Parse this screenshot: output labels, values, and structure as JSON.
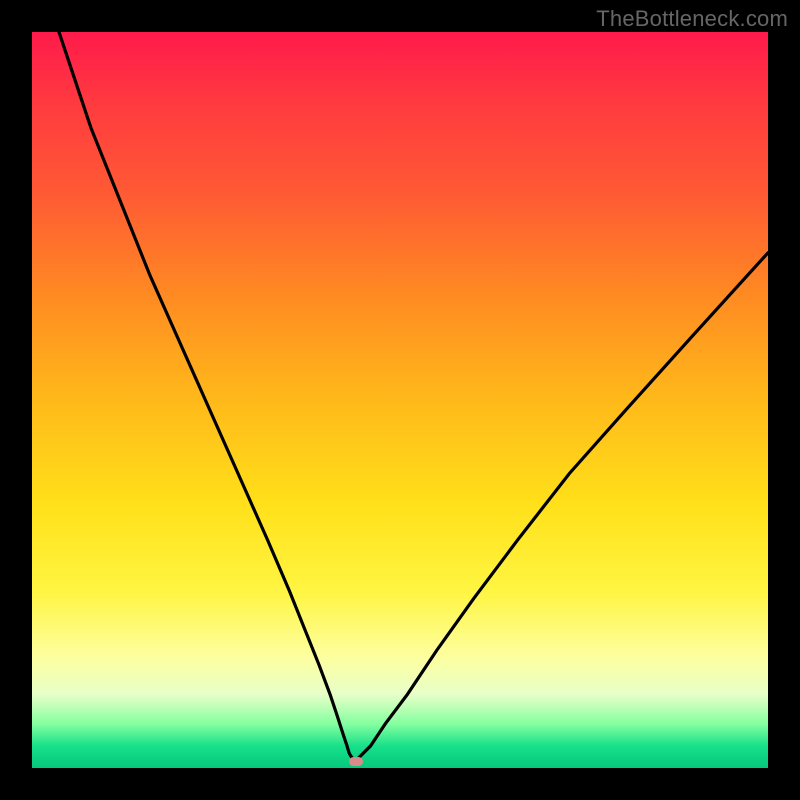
{
  "watermark": "TheBottleneck.com",
  "colors": {
    "frame_bg": "#000000",
    "curve_stroke": "#000000",
    "marker_fill": "#d98b8b",
    "gradient_stops": [
      {
        "pos": 0.0,
        "hex": "#ff1a4b"
      },
      {
        "pos": 0.1,
        "hex": "#ff3b3f"
      },
      {
        "pos": 0.22,
        "hex": "#ff5a34"
      },
      {
        "pos": 0.36,
        "hex": "#ff8b22"
      },
      {
        "pos": 0.5,
        "hex": "#ffb91a"
      },
      {
        "pos": 0.64,
        "hex": "#ffe019"
      },
      {
        "pos": 0.76,
        "hex": "#fff542"
      },
      {
        "pos": 0.85,
        "hex": "#fdffa0"
      },
      {
        "pos": 0.9,
        "hex": "#e7ffc8"
      },
      {
        "pos": 0.94,
        "hex": "#85ffa0"
      },
      {
        "pos": 0.97,
        "hex": "#18e08a"
      },
      {
        "pos": 1.0,
        "hex": "#06c87c"
      }
    ]
  },
  "chart_data": {
    "type": "line",
    "title": "",
    "xlabel": "",
    "ylabel": "",
    "xlim": [
      0,
      100
    ],
    "ylim": [
      0,
      100
    ],
    "x": [
      0,
      2,
      5,
      8,
      12,
      16,
      20,
      24,
      28,
      32,
      35,
      37,
      39,
      40.5,
      41.5,
      42.3,
      42.8,
      43.1,
      43.4,
      43.7,
      44,
      46,
      48,
      51,
      55,
      60,
      66,
      73,
      81,
      90,
      100
    ],
    "values": [
      112,
      105,
      96,
      87,
      77,
      67,
      58,
      49,
      40,
      31,
      24,
      19,
      14,
      10,
      7,
      4.5,
      3,
      2,
      1.5,
      1.2,
      1,
      3,
      6,
      10,
      16,
      23,
      31,
      40,
      49,
      59,
      70
    ],
    "minimum": {
      "x": 44,
      "y": 1
    },
    "notes": "V-shaped bottleneck curve; y-values are relative bottleneck percentage read from vertical position where 0 = bottom (green) and 100 = top (red). Minimum (optimal match) occurs near x ≈ 44."
  },
  "marker": {
    "x_pct": 44,
    "y_pct": 1
  }
}
